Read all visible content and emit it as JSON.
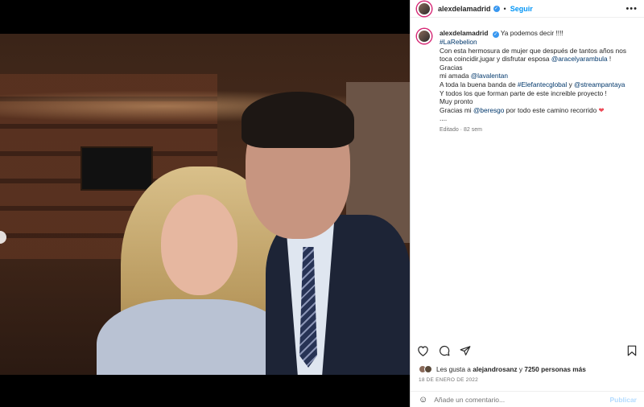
{
  "header": {
    "username": "alexdelamadrid",
    "separator": "•",
    "follow_label": "Seguir",
    "more_label": "•••"
  },
  "caption": {
    "username": "alexdelamadrid",
    "title": "Ya podemos decir !!!!",
    "hashtag1": "#LaRebelion",
    "line1": "Con esta hermosura de mujer que después de tantos años nos toca coincidir,jugar y disfrutar esposa",
    "mention1": "@aracelyarambula",
    "line1_end": " !",
    "line2": "Gracias",
    "line3": "mi amada",
    "mention2": "@lavalentan",
    "line4": "A toda la buena banda de",
    "hashtag2": "#Elefantecglobal",
    "line4_mid": " y ",
    "mention3": "@streampantaya",
    "line5": "Y todos los que forman parte de este increible proyecto !",
    "line6": "Muy pronto",
    "line7": "Gracias mi",
    "mention4": "@beresgo",
    "line7_end": " por todo este camino recorrido ",
    "heart": "❤",
    "dots": "....",
    "edited": "Editado · 82 sem"
  },
  "actions": {
    "like_icon": "heart-outline-icon",
    "comment_icon": "comment-icon",
    "share_icon": "share-icon",
    "save_icon": "bookmark-icon"
  },
  "likes": {
    "prefix": "Les gusta a",
    "user": "alejandrosanz",
    "mid": " y ",
    "others": "7250 personas más"
  },
  "date": "18 DE ENERO DE 2022",
  "comment": {
    "placeholder": "Añade un comentario...",
    "post_label": "Publicar"
  }
}
